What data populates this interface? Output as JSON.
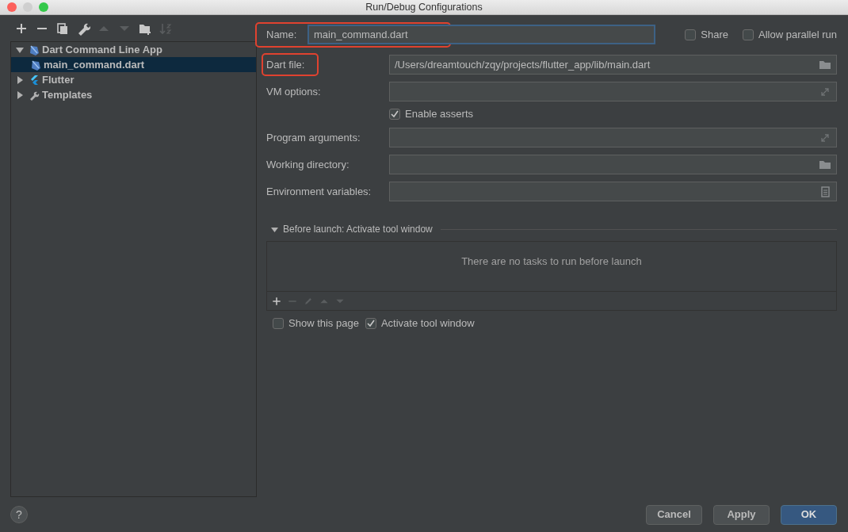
{
  "window": {
    "title": "Run/Debug Configurations"
  },
  "toolbar": [
    {
      "kind": "add",
      "disabled": false
    },
    {
      "kind": "remove",
      "disabled": false
    },
    {
      "kind": "copy",
      "disabled": false
    },
    {
      "kind": "edit",
      "disabled": false
    },
    {
      "kind": "up",
      "disabled": true
    },
    {
      "kind": "down",
      "disabled": true
    },
    {
      "kind": "folder",
      "disabled": false
    },
    {
      "kind": "sort",
      "disabled": true
    }
  ],
  "tree": [
    {
      "label": "Dart Command Line App",
      "kind": "dart",
      "expanded": true,
      "selected": false,
      "children": [
        {
          "label": "main_command.dart",
          "kind": "dart",
          "selected": true
        }
      ]
    },
    {
      "label": "Flutter",
      "kind": "flutter",
      "expanded": false,
      "selected": false
    },
    {
      "label": "Templates",
      "kind": "wrench",
      "expanded": false,
      "selected": false
    }
  ],
  "name": {
    "label": "Name:",
    "value": "main_command.dart",
    "focused": true,
    "highlighted": true
  },
  "options": [
    {
      "label": "Share",
      "checked": false
    },
    {
      "label": "Allow parallel run",
      "checked": false
    }
  ],
  "form": [
    {
      "kind": "field",
      "label": "Dart file:",
      "value": "/Users/dreamtouch/zqy/projects/flutter_app/lib/main.dart",
      "button": {
        "kind": "folder"
      },
      "highlighted": true
    },
    {
      "kind": "field",
      "label": "VM options:",
      "button": {
        "kind": "expand"
      },
      "highlighted": false
    },
    {
      "kind": "checkbox",
      "label": "Enable asserts",
      "checked": true
    },
    {
      "kind": "field",
      "label": "Program arguments:",
      "button": {
        "kind": "expand"
      },
      "highlighted": false
    },
    {
      "kind": "field",
      "label": "Working directory:",
      "button": {
        "kind": "folder"
      },
      "highlighted": false
    },
    {
      "kind": "field",
      "label": "Environment variables:",
      "button": {
        "kind": "list"
      },
      "highlighted": false
    }
  ],
  "before_launch": {
    "title": "Before launch: Activate tool window",
    "expanded": true,
    "empty_text": "There are no tasks to run before launch",
    "toolbar": [
      {
        "kind": "add",
        "disabled": false
      },
      {
        "kind": "remove",
        "disabled": true
      },
      {
        "kind": "edit",
        "disabled": true
      },
      {
        "kind": "up",
        "disabled": true
      },
      {
        "kind": "down",
        "disabled": true
      }
    ]
  },
  "launch_options": [
    {
      "label": "Show this page",
      "checked": false
    },
    {
      "label": "Activate tool window",
      "checked": true
    }
  ],
  "help": "?",
  "buttons": [
    {
      "label": "Cancel",
      "default": false
    },
    {
      "label": "Apply",
      "default": false
    },
    {
      "label": "OK",
      "default": true
    }
  ]
}
